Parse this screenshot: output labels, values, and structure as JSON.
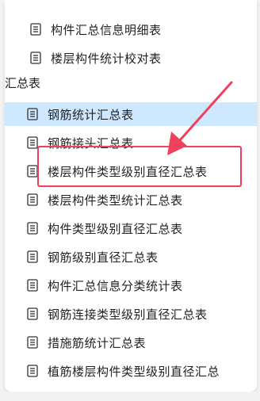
{
  "tree": {
    "top_items": [
      {
        "label": "构件汇总信息明细表"
      },
      {
        "label": "楼层构件统计校对表"
      }
    ],
    "group_label": "汇总表",
    "group_items": [
      {
        "label": "钢筋统计汇总表",
        "selected": true
      },
      {
        "label": "钢筋接头汇总表"
      },
      {
        "label": "楼层构件类型级别直径汇总表"
      },
      {
        "label": "楼层构件类型统计汇总表"
      },
      {
        "label": "构件类型级别直径汇总表"
      },
      {
        "label": "钢筋级别直径汇总表"
      },
      {
        "label": "构件汇总信息分类统计表"
      },
      {
        "label": "钢筋连接类型级别直径汇总表"
      },
      {
        "label": "措施筋统计汇总表"
      },
      {
        "label": "植筋楼层构件类型级别直径汇总"
      }
    ]
  },
  "annotation": {
    "highlight_color": "#f0405c",
    "arrow_color": "#f0405c"
  },
  "icons": {
    "item_icon": "document-icon"
  }
}
